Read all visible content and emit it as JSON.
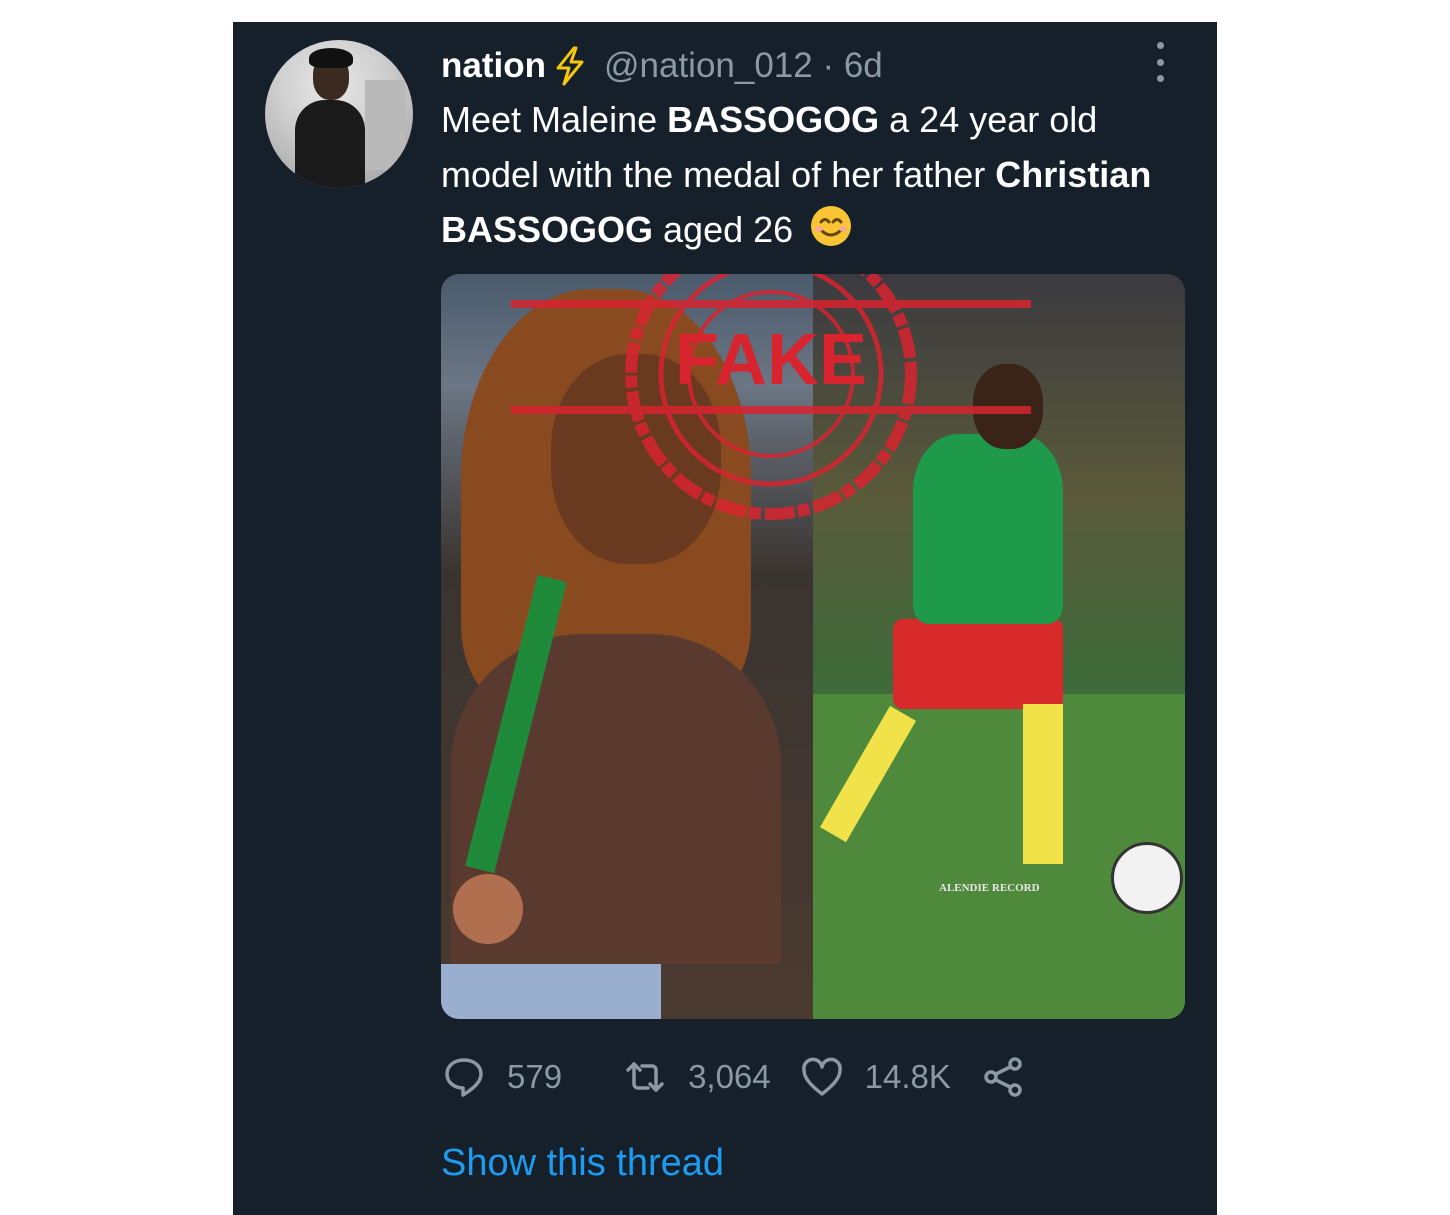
{
  "tweet": {
    "author": {
      "name": "nation",
      "handle_meta": "@nation_012 · 6d",
      "verified_emoji": "lightning-bolt-icon"
    },
    "text": {
      "part1": "Meet Maleine ",
      "bold1": "BASSOGOG",
      "part2": " a 24 year old model with the medal of her father ",
      "bold2": "Christian BASSOGOG",
      "part3": " aged 26 "
    },
    "image": {
      "stamp_text": "FAKE",
      "watermark_text": "ALENDIE RECORD"
    },
    "actions": {
      "reply_count": "579",
      "retweet_count": "3,064",
      "like_count": "14.8K"
    },
    "thread_link": "Show this thread"
  },
  "colors": {
    "background": "#15202b",
    "secondary_text": "#8b98a5",
    "link": "#1d9bf0",
    "stamp": "#d8242f"
  }
}
